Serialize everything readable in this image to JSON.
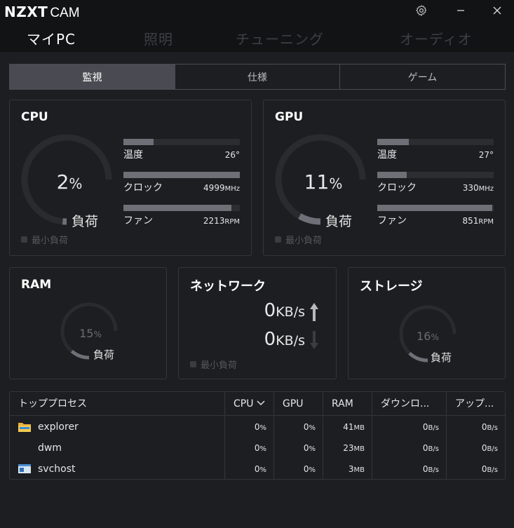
{
  "app": {
    "brand": "NZXT",
    "product": "CAM"
  },
  "nav": [
    "マイPC",
    "照明",
    "チューニング",
    "オーディオ"
  ],
  "tabs": [
    {
      "label": "監視",
      "active": true
    },
    {
      "label": "仕様",
      "active": false
    },
    {
      "label": "ゲーム",
      "active": false
    }
  ],
  "cpu": {
    "title": "CPU",
    "load_value": "2",
    "load_unit": "%",
    "load_label": "負荷",
    "load_percent": 2,
    "min_load_label": "最小負荷",
    "metrics": [
      {
        "name": "温度",
        "value": "26°",
        "unit": "",
        "fill_percent": 26
      },
      {
        "name": "クロック",
        "value": "4999",
        "unit": "MHz",
        "fill_percent": 100
      },
      {
        "name": "ファン",
        "value": "2213",
        "unit": "RPM",
        "fill_percent": 93
      }
    ]
  },
  "gpu": {
    "title": "GPU",
    "load_value": "11",
    "load_unit": "%",
    "load_label": "負荷",
    "load_percent": 11,
    "min_load_label": "最小負荷",
    "metrics": [
      {
        "name": "温度",
        "value": "27°",
        "unit": "",
        "fill_percent": 27
      },
      {
        "name": "クロック",
        "value": "330",
        "unit": "MHz",
        "fill_percent": 25
      },
      {
        "name": "ファン",
        "value": "851",
        "unit": "RPM",
        "fill_percent": 99
      }
    ]
  },
  "ram": {
    "title": "RAM",
    "load_value": "15",
    "load_unit": "%",
    "load_label": "負荷",
    "load_percent": 15
  },
  "network": {
    "title": "ネットワーク",
    "up_value": "0",
    "up_unit": "KB/s",
    "down_value": "0",
    "down_unit": "KB/s",
    "min_load_label": "最小負荷"
  },
  "storage": {
    "title": "ストレージ",
    "load_value": "16",
    "load_unit": "%",
    "load_label": "負荷",
    "load_percent": 16
  },
  "processes": {
    "headers": [
      "トッププロセス",
      "CPU",
      "GPU",
      "RAM",
      "ダウンロ...",
      "アップ..."
    ],
    "rows": [
      {
        "name": "explorer",
        "icon": "folder-icon",
        "cpu": "0",
        "gpu": "0",
        "ram": "41",
        "ram_unit": "MB",
        "down": "0",
        "down_unit": "B/s",
        "up": "0",
        "up_unit": "B/s"
      },
      {
        "name": "dwm",
        "icon": "",
        "cpu": "0",
        "gpu": "0",
        "ram": "23",
        "ram_unit": "MB",
        "down": "0",
        "down_unit": "B/s",
        "up": "0",
        "up_unit": "B/s"
      },
      {
        "name": "svchost",
        "icon": "service-window-icon",
        "cpu": "0",
        "gpu": "0",
        "ram": "3",
        "ram_unit": "MB",
        "down": "0",
        "down_unit": "B/s",
        "up": "0",
        "up_unit": "B/s"
      }
    ]
  },
  "colors": {
    "accent_fill": "#6f6f78",
    "track": "#2c2d31",
    "background": "#1d1e21"
  }
}
